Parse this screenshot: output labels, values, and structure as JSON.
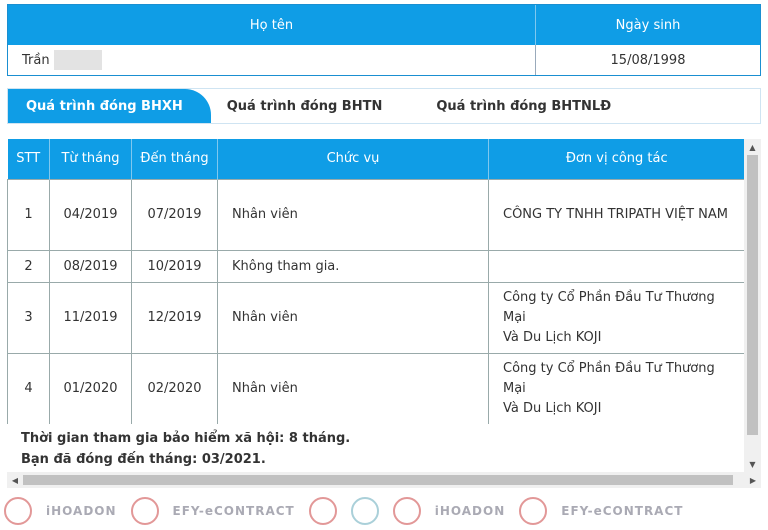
{
  "person": {
    "headers": {
      "name": "Họ tên",
      "dob": "Ngày sinh"
    },
    "name_visible": "Trần",
    "dob": "15/08/1998"
  },
  "tabs": [
    {
      "label": "Quá trình đóng BHXH",
      "active": true
    },
    {
      "label": "Quá trình đóng BHTN",
      "active": false
    },
    {
      "label": "Quá trình đóng BHTNLĐ",
      "active": false
    }
  ],
  "table": {
    "headers": [
      "STT",
      "Từ tháng",
      "Đến tháng",
      "Chức vụ",
      "Đơn vị công tác"
    ],
    "rows": [
      {
        "stt": "1",
        "tu": "04/2019",
        "den": "07/2019",
        "chucvu": "Nhân viên",
        "donvi_line1": "CÔNG TY TNHH TRIPATH VIỆT NAM",
        "donvi_line2": ""
      },
      {
        "stt": "2",
        "tu": "08/2019",
        "den": "10/2019",
        "chucvu": "Không tham gia.",
        "donvi_line1": "",
        "donvi_line2": ""
      },
      {
        "stt": "3",
        "tu": "11/2019",
        "den": "12/2019",
        "chucvu": "Nhân viên",
        "donvi_line1": "Công ty Cổ Phần Đầu Tư Thương Mại",
        "donvi_line2": "Và Du Lịch KOJI"
      },
      {
        "stt": "4",
        "tu": "01/2020",
        "den": "02/2020",
        "chucvu": "Nhân viên",
        "donvi_line1": "Công ty Cổ Phần Đầu Tư Thương Mại",
        "donvi_line2": "Và Du Lịch KOJI"
      }
    ]
  },
  "summary": {
    "line1": "Thời gian tham gia bảo hiểm xã hội: 8 tháng.",
    "line2": "Bạn đã đóng đến tháng: 03/2021."
  },
  "watermark": {
    "items": [
      "EFY",
      "iHOADON",
      "EFY",
      "EFY-eCONTRACT",
      "EFY",
      "iHOADON",
      "EFY",
      "EFY-eCONTRACT"
    ]
  },
  "colors": {
    "header_blue": "#0f9de6",
    "border": "#9aa"
  }
}
